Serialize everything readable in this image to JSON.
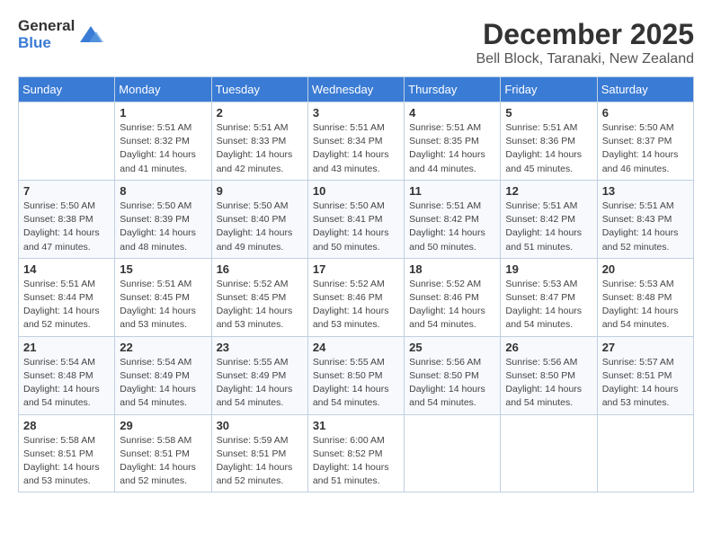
{
  "logo": {
    "general": "General",
    "blue": "Blue"
  },
  "title": {
    "month": "December 2025",
    "location": "Bell Block, Taranaki, New Zealand"
  },
  "headers": [
    "Sunday",
    "Monday",
    "Tuesday",
    "Wednesday",
    "Thursday",
    "Friday",
    "Saturday"
  ],
  "weeks": [
    [
      {
        "day": "",
        "sunrise": "",
        "sunset": "",
        "daylight": ""
      },
      {
        "day": "1",
        "sunrise": "Sunrise: 5:51 AM",
        "sunset": "Sunset: 8:32 PM",
        "daylight": "Daylight: 14 hours and 41 minutes."
      },
      {
        "day": "2",
        "sunrise": "Sunrise: 5:51 AM",
        "sunset": "Sunset: 8:33 PM",
        "daylight": "Daylight: 14 hours and 42 minutes."
      },
      {
        "day": "3",
        "sunrise": "Sunrise: 5:51 AM",
        "sunset": "Sunset: 8:34 PM",
        "daylight": "Daylight: 14 hours and 43 minutes."
      },
      {
        "day": "4",
        "sunrise": "Sunrise: 5:51 AM",
        "sunset": "Sunset: 8:35 PM",
        "daylight": "Daylight: 14 hours and 44 minutes."
      },
      {
        "day": "5",
        "sunrise": "Sunrise: 5:51 AM",
        "sunset": "Sunset: 8:36 PM",
        "daylight": "Daylight: 14 hours and 45 minutes."
      },
      {
        "day": "6",
        "sunrise": "Sunrise: 5:50 AM",
        "sunset": "Sunset: 8:37 PM",
        "daylight": "Daylight: 14 hours and 46 minutes."
      }
    ],
    [
      {
        "day": "7",
        "sunrise": "Sunrise: 5:50 AM",
        "sunset": "Sunset: 8:38 PM",
        "daylight": "Daylight: 14 hours and 47 minutes."
      },
      {
        "day": "8",
        "sunrise": "Sunrise: 5:50 AM",
        "sunset": "Sunset: 8:39 PM",
        "daylight": "Daylight: 14 hours and 48 minutes."
      },
      {
        "day": "9",
        "sunrise": "Sunrise: 5:50 AM",
        "sunset": "Sunset: 8:40 PM",
        "daylight": "Daylight: 14 hours and 49 minutes."
      },
      {
        "day": "10",
        "sunrise": "Sunrise: 5:50 AM",
        "sunset": "Sunset: 8:41 PM",
        "daylight": "Daylight: 14 hours and 50 minutes."
      },
      {
        "day": "11",
        "sunrise": "Sunrise: 5:51 AM",
        "sunset": "Sunset: 8:42 PM",
        "daylight": "Daylight: 14 hours and 50 minutes."
      },
      {
        "day": "12",
        "sunrise": "Sunrise: 5:51 AM",
        "sunset": "Sunset: 8:42 PM",
        "daylight": "Daylight: 14 hours and 51 minutes."
      },
      {
        "day": "13",
        "sunrise": "Sunrise: 5:51 AM",
        "sunset": "Sunset: 8:43 PM",
        "daylight": "Daylight: 14 hours and 52 minutes."
      }
    ],
    [
      {
        "day": "14",
        "sunrise": "Sunrise: 5:51 AM",
        "sunset": "Sunset: 8:44 PM",
        "daylight": "Daylight: 14 hours and 52 minutes."
      },
      {
        "day": "15",
        "sunrise": "Sunrise: 5:51 AM",
        "sunset": "Sunset: 8:45 PM",
        "daylight": "Daylight: 14 hours and 53 minutes."
      },
      {
        "day": "16",
        "sunrise": "Sunrise: 5:52 AM",
        "sunset": "Sunset: 8:45 PM",
        "daylight": "Daylight: 14 hours and 53 minutes."
      },
      {
        "day": "17",
        "sunrise": "Sunrise: 5:52 AM",
        "sunset": "Sunset: 8:46 PM",
        "daylight": "Daylight: 14 hours and 53 minutes."
      },
      {
        "day": "18",
        "sunrise": "Sunrise: 5:52 AM",
        "sunset": "Sunset: 8:46 PM",
        "daylight": "Daylight: 14 hours and 54 minutes."
      },
      {
        "day": "19",
        "sunrise": "Sunrise: 5:53 AM",
        "sunset": "Sunset: 8:47 PM",
        "daylight": "Daylight: 14 hours and 54 minutes."
      },
      {
        "day": "20",
        "sunrise": "Sunrise: 5:53 AM",
        "sunset": "Sunset: 8:48 PM",
        "daylight": "Daylight: 14 hours and 54 minutes."
      }
    ],
    [
      {
        "day": "21",
        "sunrise": "Sunrise: 5:54 AM",
        "sunset": "Sunset: 8:48 PM",
        "daylight": "Daylight: 14 hours and 54 minutes."
      },
      {
        "day": "22",
        "sunrise": "Sunrise: 5:54 AM",
        "sunset": "Sunset: 8:49 PM",
        "daylight": "Daylight: 14 hours and 54 minutes."
      },
      {
        "day": "23",
        "sunrise": "Sunrise: 5:55 AM",
        "sunset": "Sunset: 8:49 PM",
        "daylight": "Daylight: 14 hours and 54 minutes."
      },
      {
        "day": "24",
        "sunrise": "Sunrise: 5:55 AM",
        "sunset": "Sunset: 8:50 PM",
        "daylight": "Daylight: 14 hours and 54 minutes."
      },
      {
        "day": "25",
        "sunrise": "Sunrise: 5:56 AM",
        "sunset": "Sunset: 8:50 PM",
        "daylight": "Daylight: 14 hours and 54 minutes."
      },
      {
        "day": "26",
        "sunrise": "Sunrise: 5:56 AM",
        "sunset": "Sunset: 8:50 PM",
        "daylight": "Daylight: 14 hours and 54 minutes."
      },
      {
        "day": "27",
        "sunrise": "Sunrise: 5:57 AM",
        "sunset": "Sunset: 8:51 PM",
        "daylight": "Daylight: 14 hours and 53 minutes."
      }
    ],
    [
      {
        "day": "28",
        "sunrise": "Sunrise: 5:58 AM",
        "sunset": "Sunset: 8:51 PM",
        "daylight": "Daylight: 14 hours and 53 minutes."
      },
      {
        "day": "29",
        "sunrise": "Sunrise: 5:58 AM",
        "sunset": "Sunset: 8:51 PM",
        "daylight": "Daylight: 14 hours and 52 minutes."
      },
      {
        "day": "30",
        "sunrise": "Sunrise: 5:59 AM",
        "sunset": "Sunset: 8:51 PM",
        "daylight": "Daylight: 14 hours and 52 minutes."
      },
      {
        "day": "31",
        "sunrise": "Sunrise: 6:00 AM",
        "sunset": "Sunset: 8:52 PM",
        "daylight": "Daylight: 14 hours and 51 minutes."
      },
      {
        "day": "",
        "sunrise": "",
        "sunset": "",
        "daylight": ""
      },
      {
        "day": "",
        "sunrise": "",
        "sunset": "",
        "daylight": ""
      },
      {
        "day": "",
        "sunrise": "",
        "sunset": "",
        "daylight": ""
      }
    ]
  ]
}
